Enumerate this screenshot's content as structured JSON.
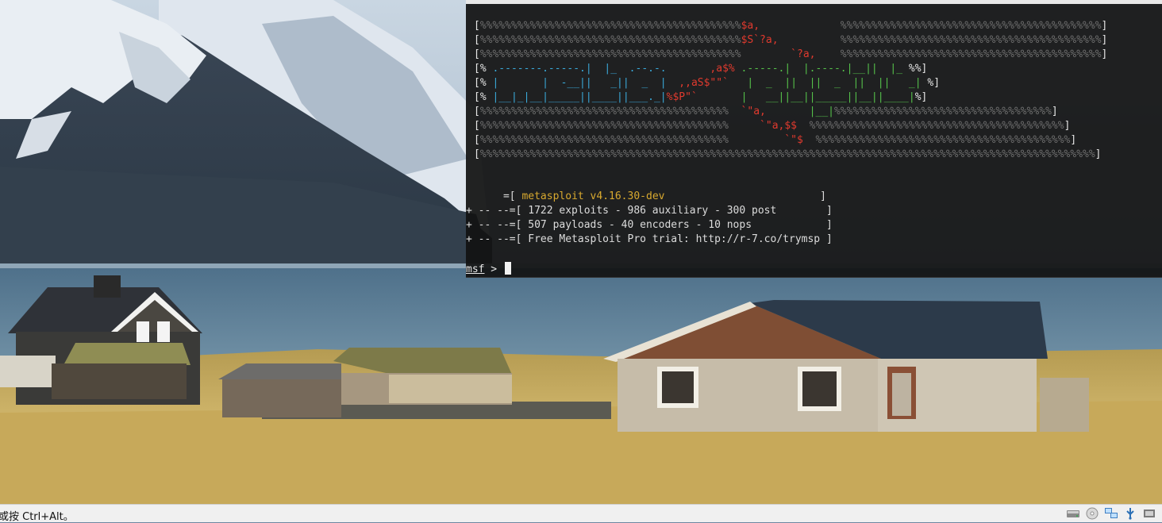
{
  "terminal": {
    "banner_lines": [
      [
        [
          "[",
          "white"
        ],
        [
          "%%%%%%%%%%%%%%%%%%%%%%%%%%%%%%%%%%%%%%%%%%",
          "gray"
        ],
        [
          "$a,",
          "red"
        ],
        [
          "             ",
          "white"
        ],
        [
          "%%%%%%%%%%%%%%%%%%%%%%%%%%%%%%%%%%%%%%%%%%",
          "gray"
        ],
        [
          "]",
          "white"
        ]
      ],
      [
        [
          "[",
          "white"
        ],
        [
          "%%%%%%%%%%%%%%%%%%%%%%%%%%%%%%%%%%%%%%%%%%",
          "gray"
        ],
        [
          "$S`?a,",
          "red"
        ],
        [
          "          ",
          "white"
        ],
        [
          "%%%%%%%%%%%%%%%%%%%%%%%%%%%%%%%%%%%%%%%%%%",
          "gray"
        ],
        [
          "]",
          "white"
        ]
      ],
      [
        [
          "[",
          "white"
        ],
        [
          "%%%%%%%%%%%%%%%%%%%%%%%%%%%%%%%%%%%%%%%%%%",
          "gray"
        ],
        [
          "        `?a,",
          "red"
        ],
        [
          "    ",
          "white"
        ],
        [
          "%%%%%%%%%%%%%%%%%%%%%%%%%%%%%%%%%%%%%%%%%%",
          "gray"
        ],
        [
          "]",
          "white"
        ]
      ],
      [
        [
          "[% ",
          "white"
        ],
        [
          ".-------.-----.|  |_  .--.-.",
          "cyan"
        ],
        [
          "       ,a$%",
          "red"
        ],
        [
          " .-----.|  |.----.|__||  |_",
          "green"
        ],
        [
          " %%]",
          "white"
        ]
      ],
      [
        [
          "[% ",
          "white"
        ],
        [
          "|       |  -__||   _||  _  |",
          "cyan"
        ],
        [
          "  ,,aS$\"\"`",
          "red"
        ],
        [
          "   |  _  ||  ||  _  ||  ||   _|",
          "green"
        ],
        [
          " %]",
          "white"
        ]
      ],
      [
        [
          "[% ",
          "white"
        ],
        [
          "|__|_|__|_____||____||___._|",
          "cyan"
        ],
        [
          "%$P\"`",
          "red"
        ],
        [
          "       |   __||__||_____||__||____|",
          "green"
        ],
        [
          "%]",
          "white"
        ]
      ],
      [
        [
          "[",
          "white"
        ],
        [
          "%%%%%%%%%%%%%%%%%%%%%%%%%%%%%%%%%%%%%%%%",
          "gray"
        ],
        [
          "  `\"a,",
          "red"
        ],
        [
          "       ",
          "white"
        ],
        [
          "|__|",
          "green"
        ],
        [
          "%%%%%%%%%%%%%%%%%%%%%%%%%%%%%%%%%%%",
          "gray"
        ],
        [
          "]",
          "white"
        ]
      ],
      [
        [
          "[",
          "white"
        ],
        [
          "%%%%%%%%%%%%%%%%%%%%%%%%%%%%%%%%%%%%%%%%",
          "gray"
        ],
        [
          "     `\"a,$$",
          "red"
        ],
        [
          "  ",
          "white"
        ],
        [
          "%%%%%%%%%%%%%%%%%%%%%%%%%%%%%%%%%%%%%%%%%",
          "gray"
        ],
        [
          "]",
          "white"
        ]
      ],
      [
        [
          "[",
          "white"
        ],
        [
          "%%%%%%%%%%%%%%%%%%%%%%%%%%%%%%%%%%%%%%%%",
          "gray"
        ],
        [
          "         `\"$",
          "red"
        ],
        [
          "  ",
          "white"
        ],
        [
          "%%%%%%%%%%%%%%%%%%%%%%%%%%%%%%%%%%%%%%%%%",
          "gray"
        ],
        [
          "]",
          "white"
        ]
      ],
      [
        [
          "[",
          "white"
        ],
        [
          "%%%%%%%%%%%%%%%%%%%%%%%%%%%%%%%%%%%%%%%%%%%%%%%%%%%%%%%%%%%%%%%%%%%%%%%%%%%%%%%%%%%%%%%%%%%%%%%%%%%",
          "gray"
        ],
        [
          "]",
          "white"
        ]
      ]
    ],
    "info_prefix_1": "      =[ ",
    "version": "metasploit v4.16.30-dev",
    "info_suffix_1": "                         ]",
    "info_line_2": "+ -- --=[ 1722 exploits - 986 auxiliary - 300 post        ]",
    "info_line_3": "+ -- --=[ 507 payloads - 40 encoders - 10 nops            ]",
    "info_line_4": "+ -- --=[ Free Metasploit Pro trial: http://r-7.co/trymsp ]",
    "prompt_name": "msf",
    "prompt_symbol": " > "
  },
  "statusbar": {
    "text": "或按 Ctrl+Alt。",
    "icons": [
      "hard-disk-icon",
      "optical-drive-icon",
      "network-icon",
      "usb-icon",
      "shared-folder-icon"
    ]
  },
  "colors": {
    "terminal_bg": "#121212",
    "banner_red": "#e03a2e",
    "banner_green": "#55c04a",
    "banner_cyan": "#3aa9d9",
    "version_yellow": "#d8a92f",
    "statusbar_bg": "#f0f0f0"
  }
}
